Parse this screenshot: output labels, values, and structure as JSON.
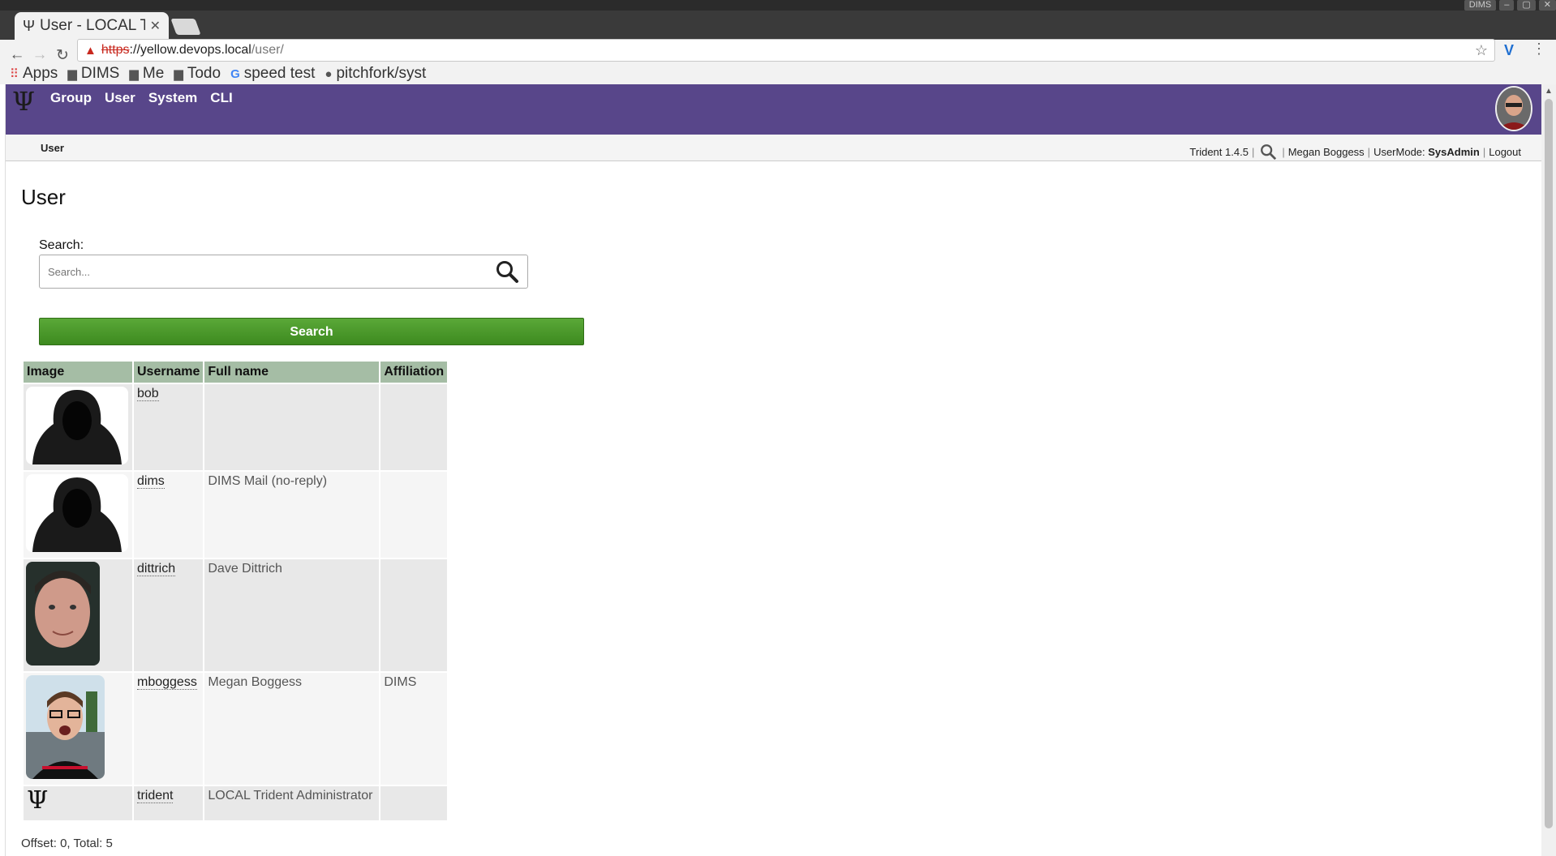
{
  "browser": {
    "tab_title": "User - LOCAL Tri",
    "tab_favicon": "trident-icon",
    "window_label": "DIMS",
    "url_protocol": "https",
    "url_host": "://yellow.devops.local",
    "url_path": "/user/",
    "bookmarks": [
      {
        "label": "Apps",
        "icon": "apps-grid-icon"
      },
      {
        "label": "DIMS",
        "icon": "folder-icon"
      },
      {
        "label": "Me",
        "icon": "folder-icon"
      },
      {
        "label": "Todo",
        "icon": "folder-icon"
      },
      {
        "label": "speed test",
        "icon": "google-icon"
      },
      {
        "label": "pitchfork/syst",
        "icon": "github-icon"
      }
    ]
  },
  "app": {
    "logo": "Ψ",
    "nav": [
      "Group",
      "User",
      "System",
      "CLI"
    ],
    "breadcrumb": "User",
    "version": "Trident 1.4.5",
    "user_name": "Megan Boggess",
    "usermode_label": "UserMode:",
    "usermode_value": "SysAdmin",
    "logout": "Logout",
    "accent": "#58468a"
  },
  "main": {
    "title": "User",
    "search_label": "Search:",
    "search_placeholder": "Search...",
    "search_button": "Search",
    "table": {
      "headers": [
        "Image",
        "Username",
        "Full name",
        "Affiliation"
      ],
      "rows": [
        {
          "image": "hooded-silhouette",
          "username": "bob",
          "fullname": "",
          "affiliation": ""
        },
        {
          "image": "hooded-silhouette",
          "username": "dims",
          "fullname": "DIMS Mail (no-reply)",
          "affiliation": ""
        },
        {
          "image": "portrait-photo",
          "username": "dittrich",
          "fullname": "Dave Dittrich",
          "affiliation": ""
        },
        {
          "image": "portrait-photo",
          "username": "mboggess",
          "fullname": "Megan Boggess",
          "affiliation": "DIMS"
        },
        {
          "image": "trident-logo",
          "username": "trident",
          "fullname": "LOCAL Trident Administrator",
          "affiliation": ""
        }
      ]
    },
    "footer": "Offset: 0, Total: 5"
  }
}
